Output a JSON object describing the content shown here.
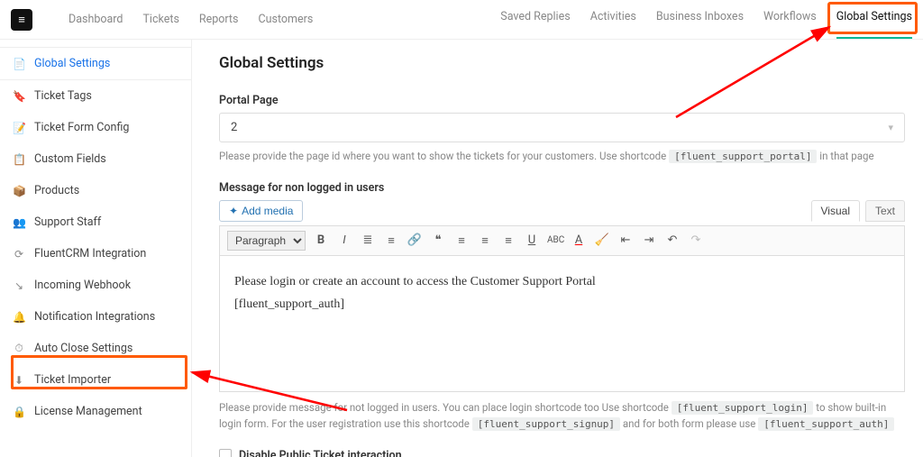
{
  "nav": {
    "left": [
      "Dashboard",
      "Tickets",
      "Reports",
      "Customers"
    ],
    "right": [
      "Saved Replies",
      "Activities",
      "Business Inboxes",
      "Workflows",
      "Global Settings"
    ]
  },
  "sidebar": {
    "items": [
      {
        "icon": "📄",
        "label": "Global Settings"
      },
      {
        "icon": "🔖",
        "label": "Ticket Tags"
      },
      {
        "icon": "📝",
        "label": "Ticket Form Config"
      },
      {
        "icon": "📋",
        "label": "Custom Fields"
      },
      {
        "icon": "📦",
        "label": "Products"
      },
      {
        "icon": "👥",
        "label": "Support Staff"
      },
      {
        "icon": "⟳",
        "label": "FluentCRM Integration"
      },
      {
        "icon": "↘",
        "label": "Incoming Webhook"
      },
      {
        "icon": "🔔",
        "label": "Notification Integrations"
      },
      {
        "icon": "⏱",
        "label": "Auto Close Settings"
      },
      {
        "icon": "⬇",
        "label": "Ticket Importer"
      },
      {
        "icon": "🔒",
        "label": "License Management"
      }
    ]
  },
  "page": {
    "title": "Global Settings",
    "portal_label": "Portal Page",
    "portal_value": "2",
    "portal_help_before": "Please provide the page id where you want to show the tickets for your customers. Use shortcode ",
    "portal_help_code": "[fluent_support_portal]",
    "portal_help_after": " in that page",
    "msg_label": "Message for non logged in users",
    "add_media": "Add media",
    "tab_visual": "Visual",
    "tab_text": "Text",
    "fmt": "Paragraph",
    "editor_line1": "Please login or create an account to access the Customer Support Portal",
    "editor_line2": "[fluent_support_auth]",
    "help2_a": "Please provide message for not logged in users. You can place login shortcode too Use shortcode ",
    "help2_code1": "[fluent_support_login]",
    "help2_b": " to show built-in login form. For the user registration use this shortcode ",
    "help2_code2": "[fluent_support_signup]",
    "help2_c": " and for both form please use ",
    "help2_code3": "[fluent_support_auth]",
    "checkbox": "Disable Public Ticket interaction"
  }
}
